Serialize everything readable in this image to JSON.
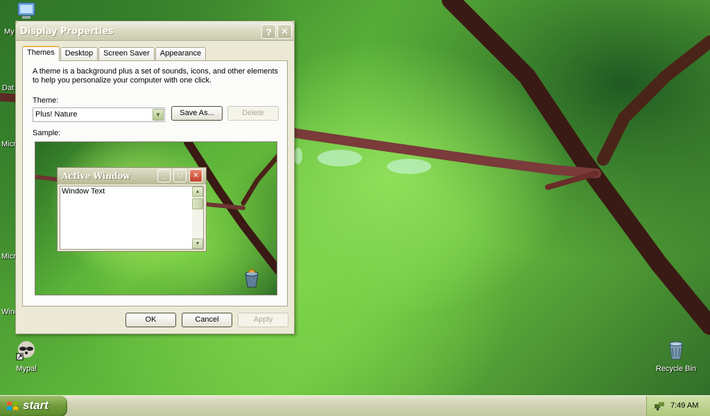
{
  "desktop": {
    "icons": [
      {
        "label": "Mypal",
        "icon": "raccoon-icon"
      },
      {
        "label": "Recycle Bin",
        "icon": "recycle-bin-icon"
      }
    ],
    "clipped_labels": [
      "My",
      "Dat",
      "Micr",
      "Micr",
      "Wind"
    ]
  },
  "window": {
    "title": "Display Properties",
    "help_icon": "?",
    "close_icon": "✕",
    "tabs": [
      {
        "label": "Themes",
        "active": true
      },
      {
        "label": "Desktop",
        "active": false
      },
      {
        "label": "Screen Saver",
        "active": false
      },
      {
        "label": "Appearance",
        "active": false
      }
    ],
    "description": "A theme is a background plus a set of sounds, icons, and other elements to help you personalize your computer with one click.",
    "theme_label": "Theme:",
    "theme_value": "Plus! Nature",
    "save_as_label": "Save As...",
    "delete_label": "Delete",
    "sample_label": "Sample:",
    "sample": {
      "window_title": "Active Window",
      "window_text": "Window Text"
    },
    "ok_label": "OK",
    "cancel_label": "Cancel",
    "apply_label": "Apply"
  },
  "taskbar": {
    "start_label": "start",
    "clock": "7:49 AM"
  },
  "colors": {
    "accent": "#e9b652",
    "start_green": "#6f9a3b"
  }
}
